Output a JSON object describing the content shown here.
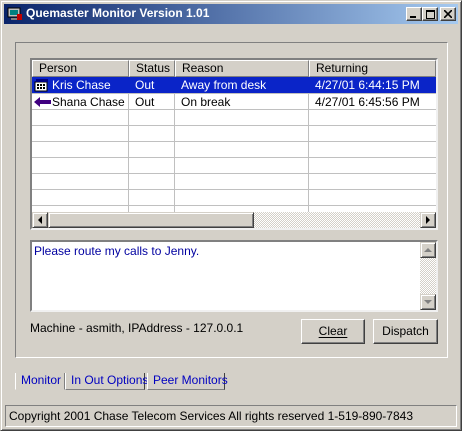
{
  "window": {
    "title": "Quemaster Monitor Version 1.01"
  },
  "grid": {
    "columns": [
      "Person",
      "Status",
      "Reason",
      "Returning"
    ],
    "rows": [
      {
        "person": "Kris Chase",
        "status": "Out",
        "reason": "Away from desk",
        "returning": "4/27/01 6:44:15 PM",
        "icon": "phone-icon",
        "selected": true
      },
      {
        "person": "Shana Chase",
        "status": "Out",
        "reason": "On break",
        "returning": "4/27/01 6:45:56 PM",
        "icon": "left-arrow-icon",
        "selected": false
      }
    ]
  },
  "message": {
    "text": "Please route my calls to Jenny."
  },
  "machine_info": "Machine - asmith, IPAddress - 127.0.0.1",
  "buttons": {
    "clear": "Clear",
    "dispatch": "Dispatch"
  },
  "tabs": [
    "Monitor",
    "In Out Options",
    "Peer Monitors"
  ],
  "status_bar": "Copyright 2001 Chase Telecom Services All rights reserved 1-519-890-7843",
  "colors": {
    "selection": "#0a24c8",
    "title_start": "#0a246a",
    "title_end": "#a6caf0",
    "tab_text": "#0000c0",
    "message_text": "#0000a0"
  }
}
